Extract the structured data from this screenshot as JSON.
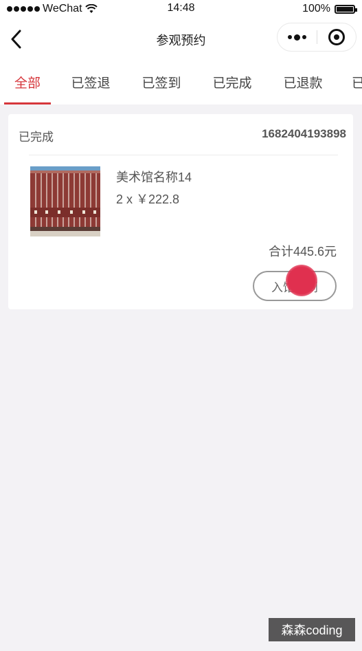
{
  "status_bar": {
    "carrier": "WeChat",
    "time": "14:48",
    "battery": "100%"
  },
  "nav": {
    "title": "参观预约",
    "back_icon": "chevron-left-icon",
    "more_icon": "more-dots-icon",
    "close_icon": "target-close-icon"
  },
  "tabs": [
    {
      "label": "全部",
      "active": true
    },
    {
      "label": "已签退",
      "active": false
    },
    {
      "label": "已签到",
      "active": false
    },
    {
      "label": "已完成",
      "active": false
    },
    {
      "label": "已退款",
      "active": false
    },
    {
      "label": "已",
      "active": false
    }
  ],
  "order": {
    "status": "已完成",
    "order_no": "1682404193898",
    "item_name": "美术馆名称14",
    "quantity_price": "2 x ￥222.8",
    "total": "合计445.6元",
    "checkin_button": "入馆签到"
  },
  "colors": {
    "accent": "#d6363b",
    "background": "#f3f2f5"
  },
  "watermark": "森森coding"
}
